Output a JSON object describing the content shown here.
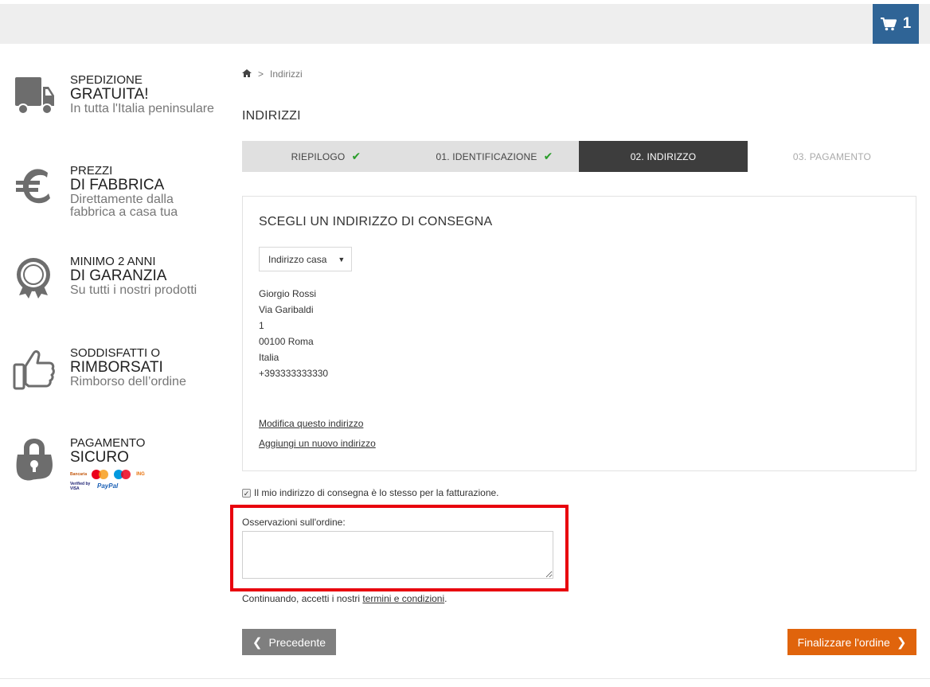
{
  "header": {
    "cart_count": "1",
    "cart_icon": "cart-icon"
  },
  "sidebar": {
    "features": [
      {
        "icon": "truck-icon",
        "line1": "SPEDIZIONE",
        "line2": "GRATUITA!",
        "line3": "In tutta l'Italia peninsulare"
      },
      {
        "icon": "euro-icon",
        "line1": "PREZZI",
        "line2": "DI FABBRICA",
        "line3": "Direttamente dalla fabbrica a casa tua"
      },
      {
        "icon": "award-ribbon-icon",
        "line1": "MINIMO 2 ANNI",
        "line2": "DI GARANZIA",
        "line3": "Su tutti i nostri prodotti"
      },
      {
        "icon": "thumbs-up-icon",
        "line1": "SODDISFATTI O",
        "line2": "RIMBORSATI",
        "line3": "Rimborso dell’ordine"
      },
      {
        "icon": "padlock-icon",
        "line1": "PAGAMENTO",
        "line2": "SICURO"
      }
    ],
    "payment_logos": [
      "Bancaria",
      "MasterCard",
      "Maestro",
      "ING",
      "Verified by VISA",
      "PayPal"
    ]
  },
  "breadcrumb": {
    "home_icon": "home-icon",
    "separator": ">",
    "current": "Indirizzi"
  },
  "page_title": "INDIRIZZI",
  "steps": [
    {
      "label": "RIEPILOGO",
      "state": "done"
    },
    {
      "label": "01. IDENTIFICAZIONE",
      "state": "done"
    },
    {
      "label": "02. INDIRIZZO",
      "state": "active"
    },
    {
      "label": "03. PAGAMENTO",
      "state": "todo"
    }
  ],
  "address_box": {
    "title": "SCEGLI UN INDIRIZZO DI CONSEGNA",
    "select_value": "Indirizzo casa",
    "lines": [
      "Giorgio Rossi",
      "Via Garibaldi",
      "1",
      "00100 Roma",
      "Italia",
      "+393333333330"
    ],
    "edit_link": "Modifica questo indirizzo",
    "add_link": "Aggiungi un nuovo indirizzo"
  },
  "billing_same": {
    "checked": true,
    "label": "Il mio indirizzo di consegna è lo stesso per la fatturazione."
  },
  "notes": {
    "label": "Osservazioni sull'ordine:",
    "value": ""
  },
  "terms": {
    "prefix": "Continuando, accetti i nostri ",
    "link": "termini e condizioni",
    "suffix": "."
  },
  "buttons": {
    "prev": "Precedente",
    "next": "Finalizzare l'ordine"
  },
  "colors": {
    "cart": "#2f6496",
    "active_step": "#3d3d3d",
    "check": "#2a9d2a",
    "highlight": "#e8000d",
    "next_button": "#e0640c",
    "prev_button": "#7f7f7f"
  }
}
